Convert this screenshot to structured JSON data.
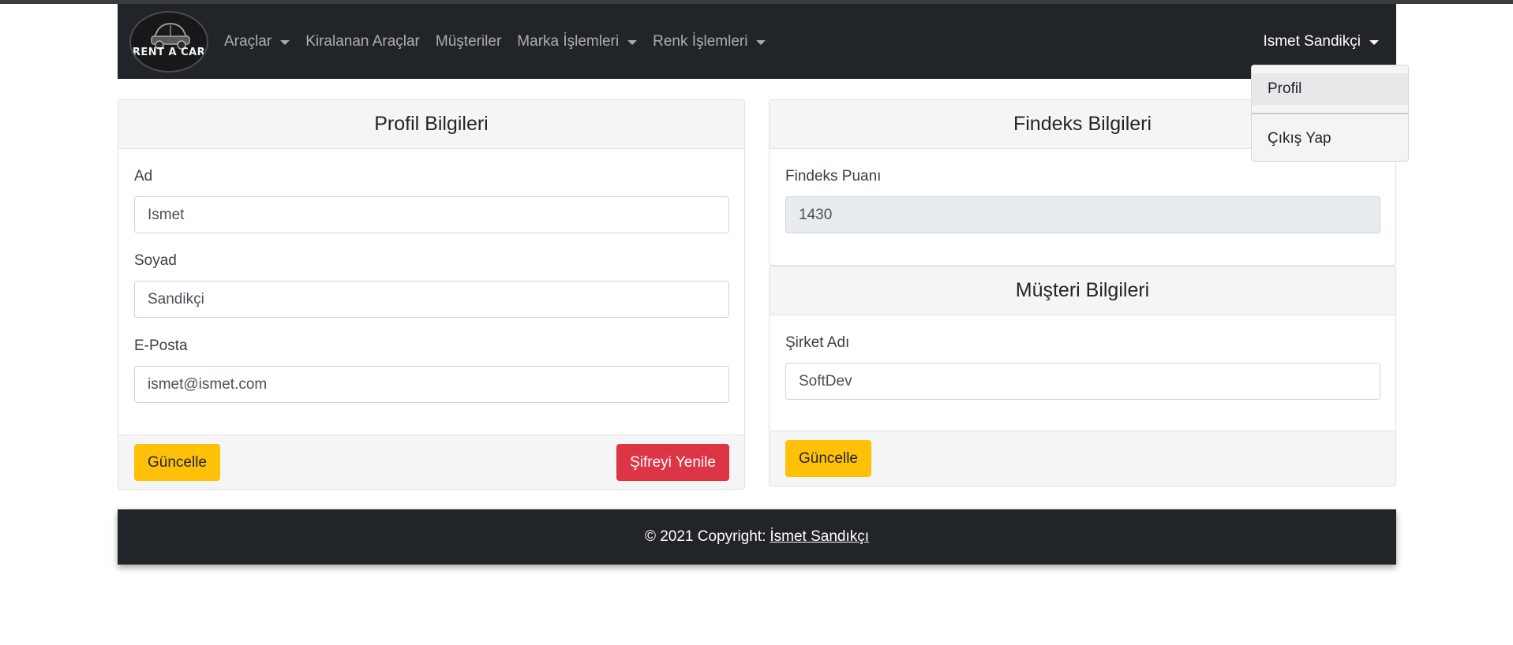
{
  "navbar": {
    "logo_text": "RENT A CAR",
    "items": [
      {
        "label": "Araçlar",
        "dropdown": true
      },
      {
        "label": "Kiralanan Araçlar",
        "dropdown": false
      },
      {
        "label": "Müşteriler",
        "dropdown": false
      },
      {
        "label": "Marka İşlemleri",
        "dropdown": true
      },
      {
        "label": "Renk İşlemleri",
        "dropdown": true
      }
    ],
    "user_name": "Ismet Sandikçi"
  },
  "user_dropdown": {
    "items": [
      {
        "label": "Profil",
        "active": true
      },
      {
        "label": "Çıkış Yap",
        "active": false
      }
    ]
  },
  "profile_card": {
    "title": "Profil Bilgileri",
    "fields": [
      {
        "label": "Ad",
        "value": "Ismet"
      },
      {
        "label": "Soyad",
        "value": "Sandikçi"
      },
      {
        "label": "E-Posta",
        "value": "ismet@ismet.com"
      }
    ],
    "update_button": "Güncelle",
    "reset_password_button": "Şifreyi Yenile"
  },
  "findeks_card": {
    "title": "Findeks Bilgileri",
    "score_label": "Findeks Puanı",
    "score_value": "1430"
  },
  "customer_card": {
    "title": "Müşteri Bilgileri",
    "company_label": "Şirket Adı",
    "company_value": "SoftDev",
    "update_button": "Güncelle"
  },
  "footer": {
    "copyright": "© 2021 Copyright:",
    "author": "İsmet Sandıkçı"
  },
  "colors": {
    "navbar_bg": "#212529",
    "warning": "#ffc107",
    "danger": "#dc3545",
    "card_header_bg": "#f5f5f5"
  }
}
